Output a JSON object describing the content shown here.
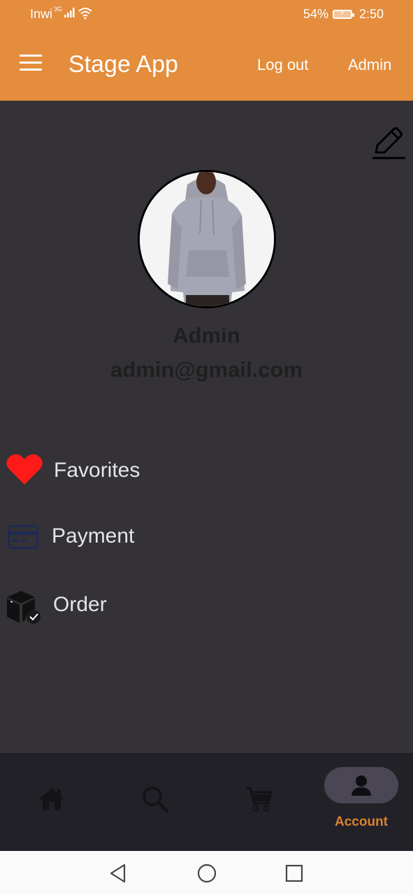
{
  "status_bar": {
    "carrier": "Inwi",
    "network_type": "3G",
    "battery_percent": "54%",
    "time": "2:50",
    "icons": [
      "signal-icon",
      "wifi-icon",
      "battery-charging-icon"
    ]
  },
  "app_bar": {
    "title": "Stage App",
    "logout_label": "Log out",
    "admin_label": "Admin",
    "background_color": "#E38D3D"
  },
  "profile": {
    "name": "Admin",
    "email": "admin@gmail.com"
  },
  "menu": [
    {
      "label": "Favorites",
      "icon": "heart-icon"
    },
    {
      "label": "Payment",
      "icon": "credit-card-icon"
    },
    {
      "label": "Order",
      "icon": "package-check-icon"
    }
  ],
  "bottom_nav": {
    "items": [
      {
        "icon": "home-icon"
      },
      {
        "icon": "search-icon"
      },
      {
        "icon": "cart-icon"
      },
      {
        "icon": "account-icon",
        "label": "Account",
        "active": true
      }
    ],
    "active_color": "#D9822F"
  },
  "colors": {
    "accent": "#E38D3D",
    "background": "#343236",
    "heart": "#FF1A1A",
    "card": "#1E2A55"
  }
}
